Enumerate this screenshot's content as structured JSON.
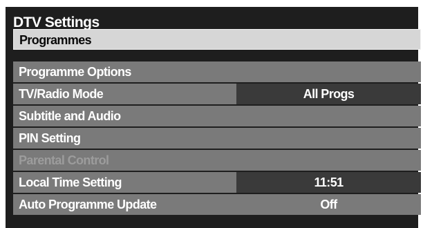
{
  "title": "DTV Settings",
  "menu": {
    "items": [
      {
        "label": "Programmes",
        "state": "selected"
      },
      {
        "label": "Programme Options"
      },
      {
        "label": "TV/Radio Mode",
        "value": "All Progs"
      },
      {
        "label": "Subtitle and Audio"
      },
      {
        "label": "PIN Setting"
      },
      {
        "label": "Parental Control",
        "state": "disabled"
      },
      {
        "label": "Local Time Setting",
        "value": "11:51"
      },
      {
        "label": "Auto Programme Update",
        "value": "Off"
      }
    ]
  },
  "colors": {
    "panel_background": "#1e1e1e",
    "row_background": "#7a7a7a",
    "selected_row": "#d6d6d6",
    "value_box": "#3a3a3a",
    "disabled_text": "#9c9c9c"
  }
}
